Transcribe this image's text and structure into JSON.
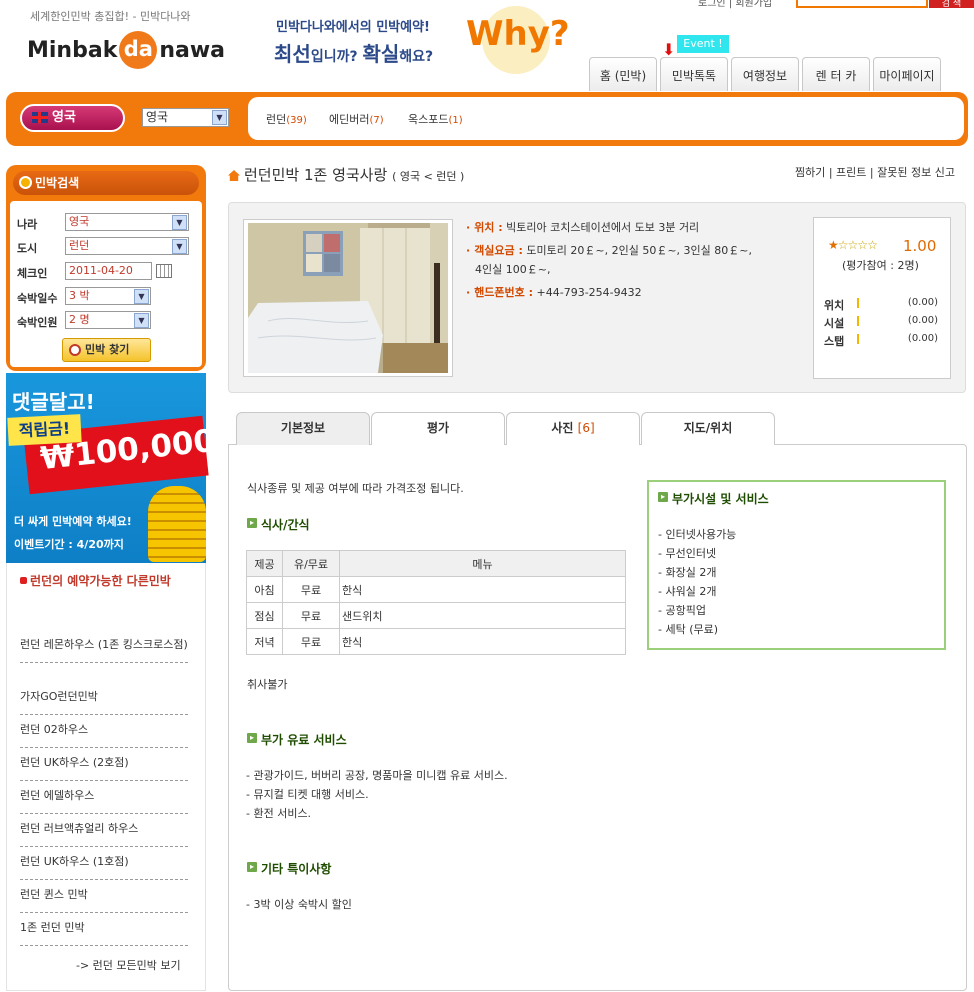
{
  "header": {
    "tagline": "세계한인민박 총집합!  -  민박다나와",
    "logo_left": "Minbak",
    "logo_mid": "da",
    "logo_right": "nawa",
    "promo_line1": "민박다나와에서의 민박예약!",
    "promo_line2_a": "최선",
    "promo_line2_b": "입니까? ",
    "promo_line2_c": "확실",
    "promo_line2_d": "해요?",
    "why": "Why?",
    "top_links": "로그인 | 회원가입",
    "top_search_button": "검 색",
    "event_badge": "Event !",
    "nav_tabs": [
      "홈 (민박)",
      "민박톡톡",
      "여행정보",
      "렌 터 카",
      "마이페이지"
    ]
  },
  "country_bar": {
    "country_pill": "영국",
    "country_select": "영국",
    "cities": [
      {
        "name": "런던",
        "count": "(39)"
      },
      {
        "name": "에딘버러",
        "count": "(7)"
      },
      {
        "name": "옥스포드",
        "count": "(1)"
      }
    ]
  },
  "search": {
    "title": "민박검색",
    "country_label": "나라",
    "country_value": "영국",
    "city_label": "도시",
    "city_value": "런던",
    "checkin_label": "체크인",
    "checkin_value": "2011-04-20",
    "nights_label": "숙박일수",
    "nights_value": "3 박",
    "people_label": "숙박인원",
    "people_value": "2 명",
    "find_button": "민박 찾기"
  },
  "banner": {
    "line1": "댓글달고!",
    "line2": "적립금!",
    "amount": "₩100,000",
    "line3": "더 싸게 민박예약 하세요!",
    "line4": "이벤트기간 : 4/20까지"
  },
  "other_minbak": {
    "title": "런던의 예약가능한 다른민박",
    "items": [
      "런던 레몬하우스 (1존 킹스크로스점)",
      "가자GO런던민박",
      "런던 02하우스",
      "런던 UK하우스 (2호점)",
      "런던 에델하우스",
      "런던 러브액츄얼리 하우스",
      "런던 UK하우스 (1호점)",
      "런던 퀸스 민박",
      "1존 런던 민박"
    ],
    "all_link": "-> 런던 모든민박 보기"
  },
  "main": {
    "title": "런던민박 1존 영국사랑",
    "breadcrumb": "( 영국 < 런던 )",
    "util_links": "찜하기 | 프린트 | 잘못된 정보 신고",
    "info": {
      "location_label": "위치 :",
      "location_value": "빅토리아 코치스테이션에서 도보 3분 거리",
      "price_label": "객실요금 :",
      "price_value_1": "도미토리 20￡~, 2인실 50￡~, 3인실 80￡~,",
      "price_value_2": "4인실 100￡~,",
      "phone_label": "핸드폰번호 :",
      "phone_value": "+44-793-254-9432"
    },
    "rating": {
      "score": "1.00",
      "stars_filled": 1,
      "stars_total": 5,
      "participants": "(평가참여 : 2명)",
      "rows": [
        {
          "label": "위치",
          "value": "(0.00)"
        },
        {
          "label": "시설",
          "value": "(0.00)"
        },
        {
          "label": "스탭",
          "value": "(0.00)"
        }
      ]
    },
    "tabs": [
      {
        "label": "기본정보",
        "count": ""
      },
      {
        "label": "평가",
        "count": ""
      },
      {
        "label": "사진",
        "count": "[6]"
      },
      {
        "label": "지도/위치",
        "count": ""
      }
    ],
    "note_price": "식사종류 및 제공 여부에 따라 가격조정 됩니다.",
    "meal_heading": "식사/간식",
    "meal_table": {
      "headers": [
        "제공",
        "유/무료",
        "메뉴"
      ],
      "rows": [
        [
          "아침",
          "무료",
          "한식"
        ],
        [
          "점심",
          "무료",
          "샌드위치"
        ],
        [
          "저녁",
          "무료",
          "한식"
        ]
      ]
    },
    "cooking_note": "취사불가",
    "paid_heading": "부가 유료 서비스",
    "paid_items": [
      "- 관광가이드, 버버리 공장, 명품마을 미니캡 유료 서비스.",
      "- 뮤지컬 티켓 대행 서비스.",
      "- 환전 서비스."
    ],
    "etc_heading": "기타 특이사항",
    "etc_items": [
      "- 3박 이상 숙박시 할인"
    ],
    "facility_heading": "부가시설 및 서비스",
    "facility_items": [
      "- 인터넷사용가능",
      "- 무선인터넷",
      "- 화장실 2개",
      "- 샤워실 2개",
      "- 공항픽업",
      "- 세탁 (무료)"
    ]
  },
  "colors": {
    "brand_orange": "#f2790c",
    "pill_pink": "#c21e5e",
    "count_orange": "#d24a00",
    "heading_green": "#1f4d00",
    "box_green": "#9bcf7a"
  }
}
